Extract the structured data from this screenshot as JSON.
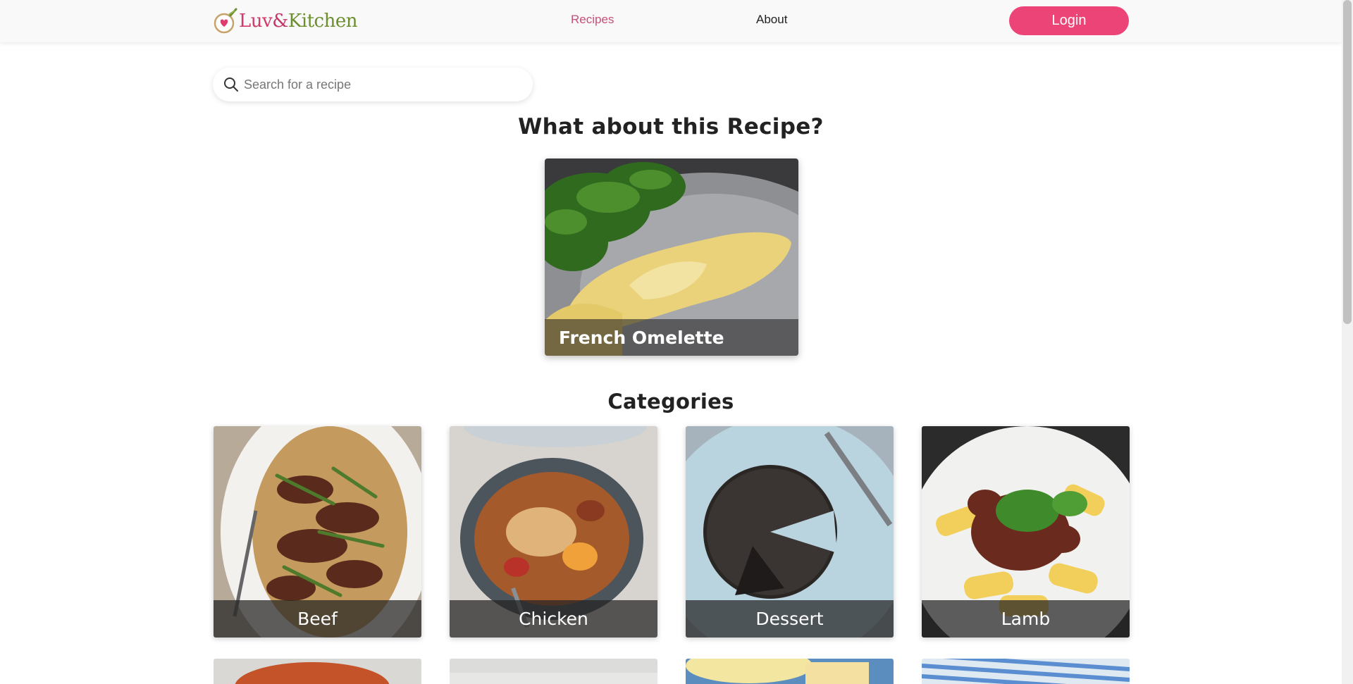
{
  "header": {
    "logo_luv": "Luv",
    "logo_amp": "&",
    "logo_kitchen": "Kitchen",
    "nav_recipes": "Recipes",
    "nav_about": "About",
    "login_label": "Login"
  },
  "search": {
    "placeholder": "Search for a recipe"
  },
  "featured": {
    "title": "What about this Recipe?",
    "recipe_name": "French Omelette"
  },
  "categories": {
    "title": "Categories",
    "items": [
      {
        "label": "Beef"
      },
      {
        "label": "Chicken"
      },
      {
        "label": "Dessert"
      },
      {
        "label": "Lamb"
      }
    ]
  },
  "colors": {
    "accent": "#ec4477",
    "nav_active": "#c94f78"
  },
  "icons": [
    "search-icon",
    "logo-heart-icon"
  ]
}
